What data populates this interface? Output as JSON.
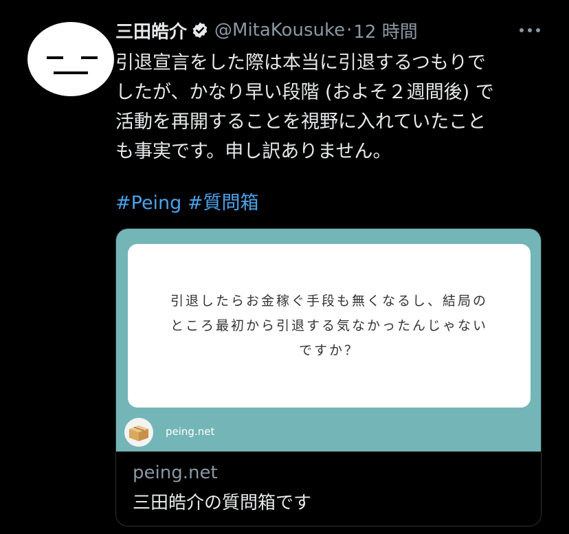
{
  "tweet": {
    "author_name": "三田皓介",
    "author_handle": "@MitaKousuke",
    "separator": "·",
    "time": "12 時間",
    "body_lines": [
      "引退宣言をした際は本当に引退するつもりで",
      "したが、かなり早い段階 (およそ２週間後) で",
      "活動を再開することを視野に入れていたこと",
      "も事実です。申し訳ありません。"
    ],
    "hashtags": [
      "#Peing",
      "#質問箱"
    ]
  },
  "card": {
    "question_lines": [
      "引退したらお金稼ぐ手段も無くなるし、結局の",
      "ところ最初から引退する気なかったんじゃない",
      "ですか？"
    ],
    "image_domain": "peing.net",
    "domain": "peing.net",
    "title": "三田皓介の質問箱です"
  },
  "icons": {
    "avatar": "face-avatar",
    "verified": "verified-badge-icon",
    "more": "more-options-icon",
    "peing_logo": "cardboard-box-icon"
  },
  "colors": {
    "background": "#000000",
    "hashtag": "#4aa3ea",
    "card_image_bg": "#74b6b7",
    "secondary_text": "#8b98a5"
  }
}
